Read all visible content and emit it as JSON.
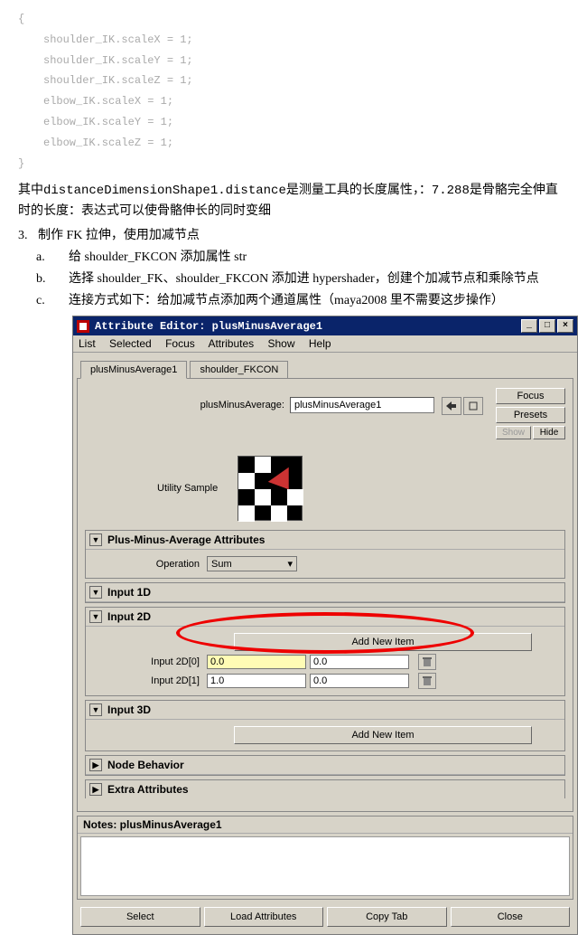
{
  "code": {
    "brace_open": "{",
    "l1": "shoulder_IK.scaleX = 1;",
    "l2": "shoulder_IK.scaleY = 1;",
    "l3": "shoulder_IK.scaleZ = 1;",
    "l4": "elbow_IK.scaleX = 1;",
    "l5": "elbow_IK.scaleY = 1;",
    "l6": "elbow_IK.scaleZ = 1;",
    "brace_close": "}"
  },
  "para1_pre": "其中",
  "para1_code": "distanceDimensionShape1.distance",
  "para1_mid": "是测量工具的长度属性，：",
  "para1_num": "7.288",
  "para1_end": "是骨骼完全伸直时的长度：表达式可以使骨骼伸长的同时变细",
  "list": {
    "n3": "3.",
    "t3": "制作 FK 拉伸，使用加减节点",
    "a_letter": "a.",
    "a_text": "给 shoulder_FKCON 添加属性 str",
    "b_letter": "b.",
    "b_text": "选择 shoulder_FK、shoulder_FKCON 添加进 hypershader，创建个加减节点和乘除节点",
    "c_letter": "c.",
    "c_text": "连接方式如下：给加减节点添加两个通道属性（maya2008 里不需要这步操作）"
  },
  "ae": {
    "title": "Attribute Editor: plusMinusAverage1",
    "menu": {
      "list": "List",
      "selected": "Selected",
      "focus": "Focus",
      "attrs": "Attributes",
      "show": "Show",
      "help": "Help"
    },
    "tabs": {
      "t1": "plusMinusAverage1",
      "t2": "shoulder_FKCON"
    },
    "name_label": "plusMinusAverage:",
    "name_value": "plusMinusAverage1",
    "btn_focus": "Focus",
    "btn_presets": "Presets",
    "btn_show": "Show",
    "btn_hide": "Hide",
    "utility_label": "Utility Sample",
    "sections": {
      "pma": "Plus-Minus-Average Attributes",
      "op_label": "Operation",
      "op_value": "Sum",
      "in1d": "Input 1D",
      "in2d": "Input 2D",
      "add_item": "Add New Item",
      "in2d0_label": "Input 2D[0]",
      "in2d0_a": "0.0",
      "in2d0_b": "0.0",
      "in2d1_label": "Input 2D[1]",
      "in2d1_a": "1.0",
      "in2d1_b": "0.0",
      "in3d": "Input 3D",
      "node_behavior": "Node Behavior",
      "extra": "Extra Attributes"
    },
    "notes_header": "Notes: plusMinusAverage1",
    "footer": {
      "select": "Select",
      "load": "Load Attributes",
      "copy": "Copy Tab",
      "close": "Close"
    }
  }
}
